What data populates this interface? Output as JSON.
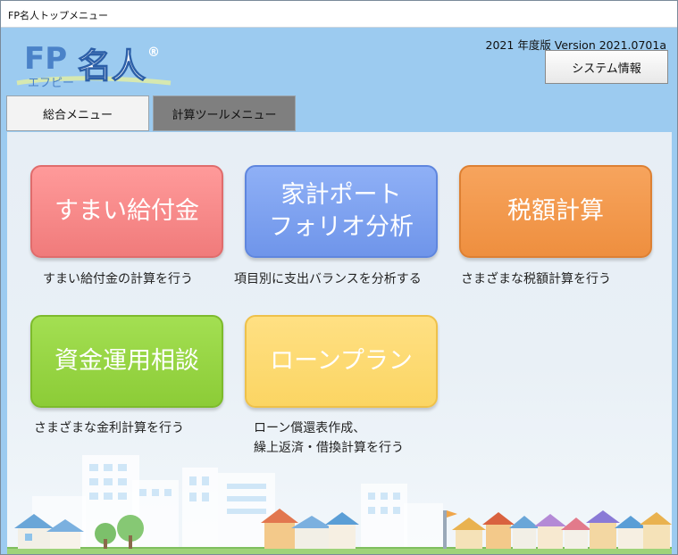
{
  "window": {
    "title": "FP名人トップメニュー"
  },
  "header": {
    "logo_text": "FP名人",
    "logo_sub": "エフピー",
    "version_text": "2021 年度版  Version 2021.0701a",
    "system_info_label": "システム情報"
  },
  "tabs": [
    {
      "label": "総合メニュー"
    },
    {
      "label": "計算ツールメニュー"
    }
  ],
  "menu": [
    {
      "label": "すまい給付金",
      "description": "すまい給付金の計算を行う",
      "color": "#f58383"
    },
    {
      "label": "家計ポート\nフォリオ分析",
      "description": "項目別に支出バランスを分析する",
      "color": "#779cee"
    },
    {
      "label": "税額計算",
      "description": "さまざまな税額計算を行う",
      "color": "#f09548"
    },
    {
      "label": "資金運用相談",
      "description": "さまざまな金利計算を行う",
      "color": "#92d33f"
    },
    {
      "label": "ローンプラン",
      "description": "ローン償還表作成、\n繰上返済・借換計算を行う",
      "color": "#fcd96b"
    }
  ]
}
